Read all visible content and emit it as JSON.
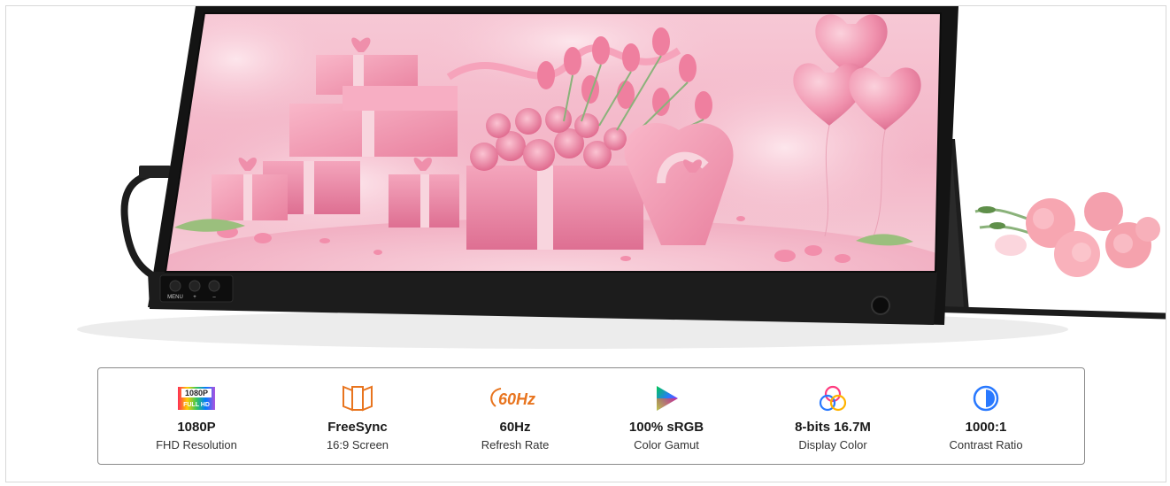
{
  "features": [
    {
      "icon": "full-hd-badge-icon",
      "badge_top": "1080P",
      "badge_bottom": "FULL HD",
      "title": "1080P",
      "subtitle": "FHD Resolution"
    },
    {
      "icon": "freesync-icon",
      "title": "FreeSync",
      "subtitle": "16:9 Screen"
    },
    {
      "icon": "60hz-icon",
      "badge_text": "60Hz",
      "title": "60Hz",
      "subtitle": "Refresh Rate"
    },
    {
      "icon": "color-gamut-triangle-icon",
      "title": "100% sRGB",
      "subtitle": "Color Gamut"
    },
    {
      "icon": "rgb-circles-icon",
      "title": "8-bits 16.7M",
      "subtitle": "Display Color"
    },
    {
      "icon": "contrast-circle-icon",
      "title": "1000:1",
      "subtitle": "Contrast Ratio"
    }
  ],
  "monitor": {
    "buttons": [
      "MENU",
      "+",
      "–"
    ]
  },
  "colors": {
    "bezel": "#141414",
    "screen_pink": "#f4b3c6",
    "accent_orange": "#e8741e",
    "box_border": "#8a8a8a"
  }
}
